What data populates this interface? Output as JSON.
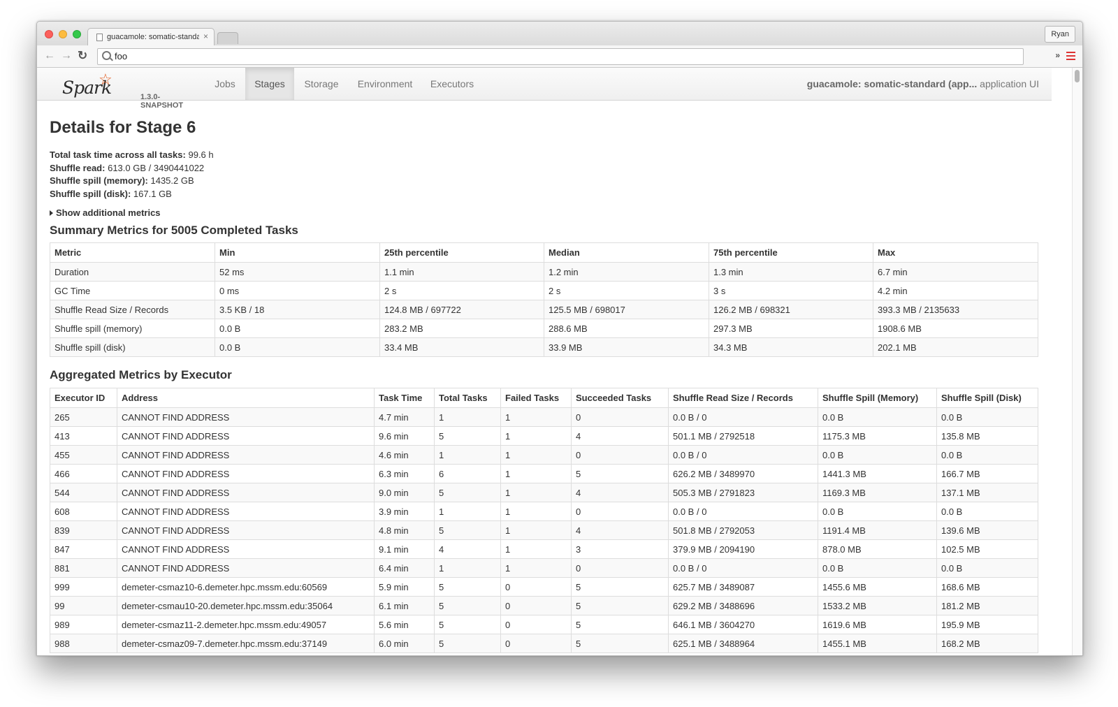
{
  "browser": {
    "tab_title": "guacamole: somatic-standard",
    "tab_close": "×",
    "profile": "Ryan",
    "address": "foo",
    "ext_arrows": "»"
  },
  "navbar": {
    "logo": "Spark",
    "version": "1.3.0-SNAPSHOT",
    "tabs": [
      "Jobs",
      "Stages",
      "Storage",
      "Environment",
      "Executors"
    ],
    "active_tab": "Stages",
    "app_name": "guacamole: somatic-standard (app...",
    "app_suffix": "application UI"
  },
  "stage": {
    "title": "Details for Stage 6",
    "metrics": [
      {
        "label": "Total task time across all tasks:",
        "value": "99.6 h"
      },
      {
        "label": "Shuffle read:",
        "value": "613.0 GB / 3490441022"
      },
      {
        "label": "Shuffle spill (memory):",
        "value": "1435.2 GB"
      },
      {
        "label": "Shuffle spill (disk):",
        "value": "167.1 GB"
      }
    ],
    "show_additional": "Show additional metrics"
  },
  "summary": {
    "title": "Summary Metrics for 5005 Completed Tasks",
    "headers": [
      "Metric",
      "Min",
      "25th percentile",
      "Median",
      "75th percentile",
      "Max"
    ],
    "rows": [
      [
        "Duration",
        "52 ms",
        "1.1 min",
        "1.2 min",
        "1.3 min",
        "6.7 min"
      ],
      [
        "GC Time",
        "0 ms",
        "2 s",
        "2 s",
        "3 s",
        "4.2 min"
      ],
      [
        "Shuffle Read Size / Records",
        "3.5 KB / 18",
        "124.8 MB / 697722",
        "125.5 MB / 698017",
        "126.2 MB / 698321",
        "393.3 MB / 2135633"
      ],
      [
        "Shuffle spill (memory)",
        "0.0 B",
        "283.2 MB",
        "288.6 MB",
        "297.3 MB",
        "1908.6 MB"
      ],
      [
        "Shuffle spill (disk)",
        "0.0 B",
        "33.4 MB",
        "33.9 MB",
        "34.3 MB",
        "202.1 MB"
      ]
    ]
  },
  "executors": {
    "title": "Aggregated Metrics by Executor",
    "headers": [
      "Executor ID",
      "Address",
      "Task Time",
      "Total Tasks",
      "Failed Tasks",
      "Succeeded Tasks",
      "Shuffle Read Size / Records",
      "Shuffle Spill (Memory)",
      "Shuffle Spill (Disk)"
    ],
    "rows": [
      [
        "265",
        "CANNOT FIND ADDRESS",
        "4.7 min",
        "1",
        "1",
        "0",
        "0.0 B / 0",
        "0.0 B",
        "0.0 B"
      ],
      [
        "413",
        "CANNOT FIND ADDRESS",
        "9.6 min",
        "5",
        "1",
        "4",
        "501.1 MB / 2792518",
        "1175.3 MB",
        "135.8 MB"
      ],
      [
        "455",
        "CANNOT FIND ADDRESS",
        "4.6 min",
        "1",
        "1",
        "0",
        "0.0 B / 0",
        "0.0 B",
        "0.0 B"
      ],
      [
        "466",
        "CANNOT FIND ADDRESS",
        "6.3 min",
        "6",
        "1",
        "5",
        "626.2 MB / 3489970",
        "1441.3 MB",
        "166.7 MB"
      ],
      [
        "544",
        "CANNOT FIND ADDRESS",
        "9.0 min",
        "5",
        "1",
        "4",
        "505.3 MB / 2791823",
        "1169.3 MB",
        "137.1 MB"
      ],
      [
        "608",
        "CANNOT FIND ADDRESS",
        "3.9 min",
        "1",
        "1",
        "0",
        "0.0 B / 0",
        "0.0 B",
        "0.0 B"
      ],
      [
        "839",
        "CANNOT FIND ADDRESS",
        "4.8 min",
        "5",
        "1",
        "4",
        "501.8 MB / 2792053",
        "1191.4 MB",
        "139.6 MB"
      ],
      [
        "847",
        "CANNOT FIND ADDRESS",
        "9.1 min",
        "4",
        "1",
        "3",
        "379.9 MB / 2094190",
        "878.0 MB",
        "102.5 MB"
      ],
      [
        "881",
        "CANNOT FIND ADDRESS",
        "6.4 min",
        "1",
        "1",
        "0",
        "0.0 B / 0",
        "0.0 B",
        "0.0 B"
      ],
      [
        "999",
        "demeter-csmaz10-6.demeter.hpc.mssm.edu:60569",
        "5.9 min",
        "5",
        "0",
        "5",
        "625.7 MB / 3489087",
        "1455.6 MB",
        "168.6 MB"
      ],
      [
        "99",
        "demeter-csmau10-20.demeter.hpc.mssm.edu:35064",
        "6.1 min",
        "5",
        "0",
        "5",
        "629.2 MB / 3488696",
        "1533.2 MB",
        "181.2 MB"
      ],
      [
        "989",
        "demeter-csmaz11-2.demeter.hpc.mssm.edu:49057",
        "5.6 min",
        "5",
        "0",
        "5",
        "646.1 MB / 3604270",
        "1619.6 MB",
        "195.9 MB"
      ],
      [
        "988",
        "demeter-csmaz09-7.demeter.hpc.mssm.edu:37149",
        "6.0 min",
        "5",
        "0",
        "5",
        "625.1 MB / 3488964",
        "1455.1 MB",
        "168.2 MB"
      ]
    ]
  }
}
